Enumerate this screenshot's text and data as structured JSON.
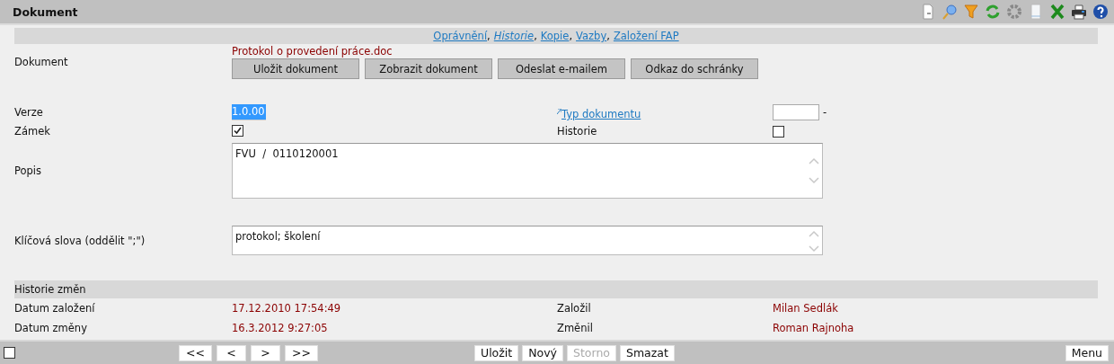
{
  "window": {
    "title": "Dokument"
  },
  "links": [
    {
      "label": "Oprávnění",
      "italic": false,
      "separator": ","
    },
    {
      "label": "Historie",
      "italic": true,
      "separator": ","
    },
    {
      "label": "Kopie",
      "italic": false,
      "separator": ","
    },
    {
      "label": "Vazby",
      "italic": false,
      "separator": ","
    },
    {
      "label": "Založení FAP",
      "italic": false
    }
  ],
  "document": {
    "label": "Dokument",
    "filename": "Protokol o provedení práce.doc",
    "buttons": [
      "Uložit dokument",
      "Zobrazit dokument",
      "Odeslat e-mailem",
      "Odkaz do schránky"
    ]
  },
  "version": {
    "label": "Verze",
    "value": "1.0.00",
    "highlighted": true
  },
  "doc_type": {
    "label": "Typ dokumentu",
    "suffix": "-"
  },
  "lock": {
    "label": "Zámek",
    "checked": true
  },
  "history": {
    "label": "Historie",
    "checked": false
  },
  "description": {
    "label": "Popis",
    "value": "FVU  /  0110120001"
  },
  "keywords": {
    "label": "Klíčová slova (oddělit \";\")",
    "value": "protokol; školení"
  },
  "changes": {
    "title": "Historie změn",
    "rows": [
      {
        "label": "Datum založení",
        "value": "17.12.2010 17:54:49",
        "label_2": "Založil",
        "value_2": "Milan Sedlák"
      },
      {
        "label": "Datum změny",
        "value": "16.3.2012 9:27:05",
        "label_2": "Změnil",
        "value_2": "Roman Rajnoha"
      }
    ]
  },
  "footer": {
    "checked": false,
    "nav": [
      "<<",
      "<",
      ">",
      ">>"
    ],
    "actions": [
      {
        "label": "Uložit",
        "disabled": false
      },
      {
        "label": "Nový",
        "disabled": false
      },
      {
        "label": "Storno",
        "disabled": true
      },
      {
        "label": "Smazat",
        "disabled": false
      }
    ],
    "menu": "Menu"
  }
}
